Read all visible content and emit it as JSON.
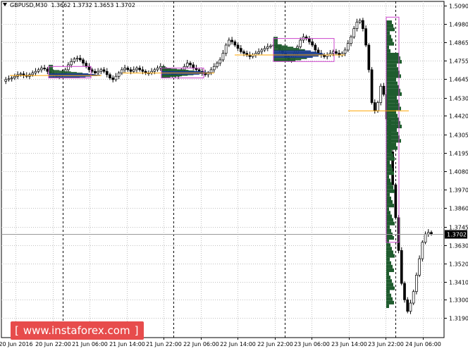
{
  "header": {
    "symbol": "GBPUSD,M30",
    "ohlc": "1.3662 1.3732 1.3653 1.3702"
  },
  "watermark": {
    "open": "[",
    "text": "www.instaforex.com",
    "close": "]"
  },
  "chart_data": {
    "type": "candlestick",
    "symbol": "GBPUSD",
    "timeframe": "M30",
    "ylim": [
      1.319,
      1.509
    ],
    "y_ticks": [
      "1.5090",
      "1.4980",
      "1.4865",
      "1.4755",
      "1.4645",
      "1.4530",
      "1.4420",
      "1.4305",
      "1.4195",
      "1.4080",
      "1.3970",
      "1.3860",
      "1.3745",
      "1.3630",
      "1.3520",
      "1.3410",
      "1.3300",
      "1.3190"
    ],
    "x_ticks": [
      "20 Jun 2016",
      "20 Jun 22:00",
      "21 Jun 06:00",
      "21 Jun 14:00",
      "21 Jun 22:00",
      "22 Jun 06:00",
      "22 Jun 14:00",
      "22 Jun 22:00",
      "23 Jun 06:00",
      "23 Jun 14:00",
      "23 Jun 22:00",
      "24 Jun 06:00"
    ],
    "current_price": "1.3702",
    "price_path": [
      1.463,
      1.464,
      1.4645,
      1.465,
      1.466,
      1.467,
      1.4675,
      1.4665,
      1.466,
      1.467,
      1.468,
      1.469,
      1.47,
      1.471,
      1.4705,
      1.469,
      1.468,
      1.467,
      1.466,
      1.4665,
      1.468,
      1.47,
      1.473,
      1.475,
      1.4765,
      1.477,
      1.476,
      1.474,
      1.472,
      1.47,
      1.469,
      1.468,
      1.469,
      1.47,
      1.469,
      1.467,
      1.465,
      1.464,
      1.466,
      1.468,
      1.47,
      1.471,
      1.47,
      1.469,
      1.47,
      1.471,
      1.47,
      1.469,
      1.468,
      1.468,
      1.469,
      1.47,
      1.471,
      1.472,
      1.47,
      1.469,
      1.468,
      1.467,
      1.466,
      1.468,
      1.47,
      1.472,
      1.474,
      1.473,
      1.471,
      1.47,
      1.469,
      1.468,
      1.467,
      1.468,
      1.47,
      1.472,
      1.474,
      1.476,
      1.48,
      1.485,
      1.488,
      1.487,
      1.485,
      1.483,
      1.481,
      1.48,
      1.479,
      1.478,
      1.479,
      1.48,
      1.481,
      1.482,
      1.483,
      1.484,
      1.4845,
      1.485,
      1.484,
      1.482,
      1.48,
      1.478,
      1.476,
      1.477,
      1.48,
      1.484,
      1.488,
      1.49,
      1.489,
      1.487,
      1.485,
      1.482,
      1.48,
      1.479,
      1.478,
      1.479,
      1.48,
      1.481,
      1.48,
      1.479,
      1.48,
      1.482,
      1.486,
      1.49,
      1.495,
      1.499,
      1.5,
      1.495,
      1.485,
      1.47,
      1.45,
      1.445,
      1.45,
      1.46,
      1.455,
      1.44,
      1.42,
      1.4,
      1.38,
      1.36,
      1.34,
      1.33,
      1.323,
      1.328,
      1.335,
      1.345,
      1.355,
      1.365,
      1.37,
      1.371,
      1.3702
    ],
    "volume_profiles": [
      {
        "from": "20 Jun 22:00",
        "poc": 1.4665,
        "low": 1.465,
        "high": 1.473
      },
      {
        "from": "21 Jun 22:00",
        "poc": 1.468,
        "low": 1.465,
        "high": 1.472
      },
      {
        "from": "22 Jun 22:00",
        "poc": 1.479,
        "low": 1.475,
        "high": 1.49
      },
      {
        "from": "23 Jun 22:00",
        "poc": 1.445,
        "low": 1.325,
        "high": 1.5
      }
    ],
    "colors": {
      "bull_candle": "#ffffff",
      "bear_candle": "#000000",
      "profile_fill": "#1f5c2e",
      "profile_value_area": "#1a3d8c",
      "profile_box": "#cc44cc",
      "poc_line": "#ffa500",
      "grid": "#c0c0c0",
      "session_separator": "#000000",
      "current_price_box": "#000000"
    },
    "grid": true
  }
}
